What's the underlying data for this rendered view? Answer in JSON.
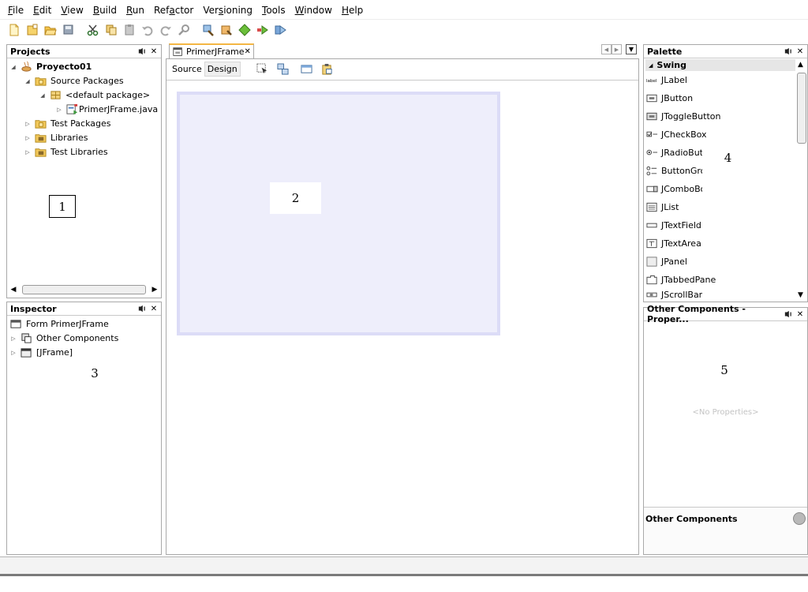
{
  "menu": [
    {
      "pre": "",
      "mn": "F",
      "post": "ile"
    },
    {
      "pre": "",
      "mn": "E",
      "post": "dit"
    },
    {
      "pre": "",
      "mn": "V",
      "post": "iew"
    },
    {
      "pre": "",
      "mn": "B",
      "post": "uild"
    },
    {
      "pre": "",
      "mn": "R",
      "post": "un"
    },
    {
      "pre": "Ref",
      "mn": "a",
      "post": "ctor"
    },
    {
      "pre": "Ver",
      "mn": "s",
      "post": "ioning"
    },
    {
      "pre": "",
      "mn": "T",
      "post": "ools"
    },
    {
      "pre": "",
      "mn": "W",
      "post": "indow"
    },
    {
      "pre": "",
      "mn": "H",
      "post": "elp"
    }
  ],
  "projects": {
    "title": "Projects",
    "tree": [
      {
        "label": "Proyecto01",
        "bold": true,
        "icon": "project-icon"
      },
      {
        "label": "Source Packages",
        "icon": "folder-icon"
      },
      {
        "label": "<default package>",
        "icon": "package-icon"
      },
      {
        "label": "PrimerJFrame.java",
        "icon": "java-form-icon"
      },
      {
        "label": "Test Packages",
        "icon": "folder-icon"
      },
      {
        "label": "Libraries",
        "icon": "library-icon"
      },
      {
        "label": "Test Libraries",
        "icon": "library-icon"
      }
    ]
  },
  "inspector": {
    "title": "Inspector",
    "tree": [
      {
        "label": "Form PrimerJFrame",
        "icon": "form-icon"
      },
      {
        "label": "Other Components",
        "icon": "components-icon"
      },
      {
        "label": "[JFrame]",
        "icon": "frame-icon"
      }
    ]
  },
  "editor": {
    "tab_label": "PrimerJFrame",
    "source_label": "Source",
    "design_label": "Design"
  },
  "palette": {
    "title": "Palette",
    "category": "Swing",
    "items": [
      "JLabel",
      "JButton",
      "JToggleButton",
      "JCheckBox",
      "JRadioButt",
      "ButtonGrou",
      "JComboBo",
      "JList",
      "JTextField",
      "JTextArea",
      "JPanel",
      "JTabbedPane",
      "JScrollBar"
    ]
  },
  "properties": {
    "title": "Other Components - Proper...",
    "empty_text": "<No Properties>",
    "footer_label": "Other Components"
  },
  "callouts": [
    "1",
    "2",
    "3",
    "4",
    "5"
  ]
}
